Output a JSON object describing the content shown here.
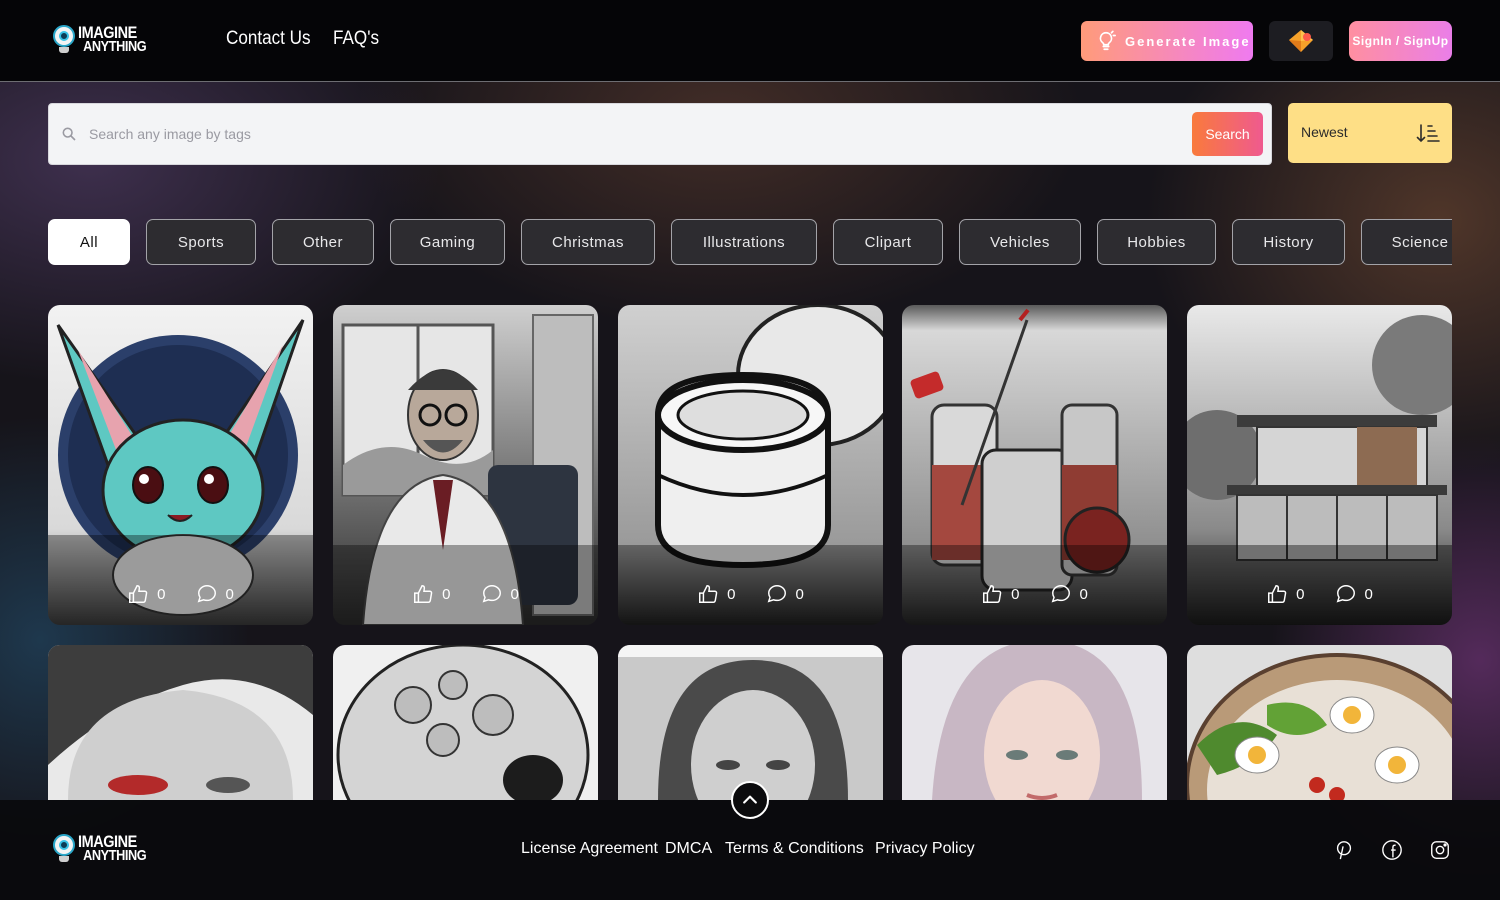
{
  "brand": {
    "line1": "IMAGINE",
    "line2": "ANYTHING"
  },
  "header": {
    "nav": [
      "Contact Us",
      "FAQ's"
    ],
    "generate_label": "Generate Image",
    "signin_label": "SignIn / SignUp"
  },
  "search": {
    "placeholder": "Search any image by tags",
    "button_label": "Search",
    "sort_label": "Newest"
  },
  "tags": [
    {
      "label": "All",
      "active": true
    },
    {
      "label": "Sports"
    },
    {
      "label": "Other"
    },
    {
      "label": "Gaming"
    },
    {
      "label": "Christmas"
    },
    {
      "label": "Illustrations"
    },
    {
      "label": "Clipart"
    },
    {
      "label": "Vehicles"
    },
    {
      "label": "Hobbies"
    },
    {
      "label": "History"
    },
    {
      "label": "Science"
    }
  ],
  "cards": [
    {
      "subject": "teal bunny creature",
      "likes": "0",
      "comments": "0"
    },
    {
      "subject": "doctor in office",
      "likes": "0",
      "comments": "0"
    },
    {
      "subject": "cream jar sketch",
      "likes": "0",
      "comments": "0"
    },
    {
      "subject": "medicine bottles and syringe",
      "likes": "0",
      "comments": "0"
    },
    {
      "subject": "modern house",
      "likes": "0",
      "comments": "0"
    },
    {
      "subject": "woman with red eye makeup"
    },
    {
      "subject": "skull with bubbles"
    },
    {
      "subject": "woman portrait sketch"
    },
    {
      "subject": "girl with pink hair"
    },
    {
      "subject": "salad with eggs"
    }
  ],
  "footer": {
    "links": [
      "License Agreement",
      "DMCA",
      "Terms & Conditions",
      "Privacy Policy"
    ],
    "social_icons": [
      "pinterest-icon",
      "facebook-icon",
      "instagram-icon"
    ]
  },
  "colors": {
    "header_bg": "#050507",
    "generate_gradient": [
      "#ff9b7a",
      "#ef7af0"
    ],
    "search_button_gradient": [
      "#f97a3c",
      "#ef5a8f"
    ],
    "sort_bg": "#fedf86"
  }
}
